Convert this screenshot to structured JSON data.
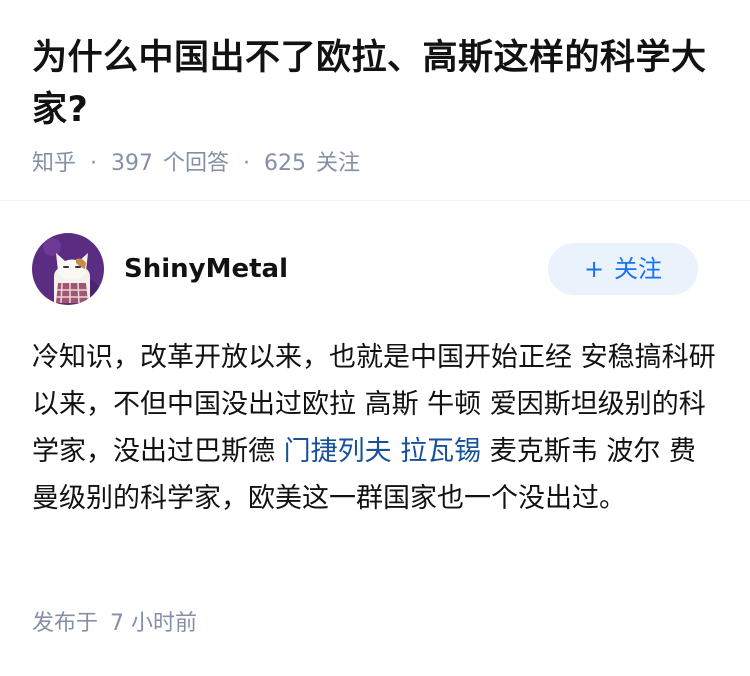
{
  "question": {
    "title": "为什么中国出不了欧拉、高斯这样的科学大家?",
    "site": "知乎",
    "separator": "·",
    "answer_count": "397",
    "answer_label": "个回答",
    "follower_count": "625",
    "follower_label": "关注"
  },
  "answer": {
    "author_name": "ShinyMetal",
    "follow_button": {
      "plus": "+",
      "label": "关注"
    },
    "content": {
      "text1": "冷知识，改革开放以来，也就是中国开始正经 安稳搞科研以来，不但中国没出过欧拉 高斯 牛顿 爱因斯坦级别的科学家，没出过巴斯德 ",
      "link1": "门捷列夫",
      "gap": " ",
      "link2": "拉瓦锡",
      "text2": " 麦克斯韦 波尔 费曼级别的科学家，欧美这一群国家也一个没出过。"
    },
    "published_label": "发布于",
    "published_time": "7 小时前"
  },
  "colors": {
    "title": "#121212",
    "meta": "#8590a6",
    "link": "#175199",
    "follow_bg": "#eaf2fc",
    "follow_text": "#1772f6",
    "avatar_bg": "#5b2d82"
  },
  "icons": {
    "avatar": "cat-avatar-icon"
  }
}
